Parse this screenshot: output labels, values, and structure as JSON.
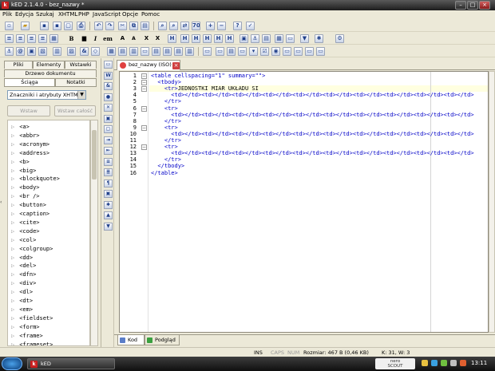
{
  "window": {
    "title": "kED 2.1.4.0 - bez_nazwy *",
    "app_icon": "k"
  },
  "menu": [
    "Plik",
    "Edycja",
    "Szukaj",
    "XHTML",
    "PHP",
    "JavaScript",
    "Opcje",
    "Pomoc"
  ],
  "toolbar2": {
    "bold": "B",
    "italic": "I",
    "em": "em",
    "big_a": "A",
    "small_a": "A",
    "sub_x": "X",
    "sup_x": "X"
  },
  "left_panel": {
    "tabs_row1": [
      "Pliki",
      "Elementy",
      "Wstawki"
    ],
    "tab_tree": "Drzewo dokumentu",
    "tabs_row2": [
      "Ściąga",
      "Notatki"
    ],
    "filter_value": "Znaczniki i atrybuty XHTML",
    "insert_button": "Wstaw",
    "insert_all_button": "Wstaw całość",
    "tags": [
      "<a>",
      "<abbr>",
      "<acronym>",
      "<address>",
      "<b>",
      "<big>",
      "<blockquote>",
      "<body>",
      "<br />",
      "<button>",
      "<caption>",
      "<cite>",
      "<code>",
      "<col>",
      "<colgroup>",
      "<dd>",
      "<del>",
      "<dfn>",
      "<div>",
      "<dl>",
      "<dt>",
      "<em>",
      "<fieldset>",
      "<form>",
      "<frame>",
      "<frameset>"
    ]
  },
  "editor": {
    "tab_label": "bez_nazwy (ISO)",
    "line_numbers": [
      "1",
      "2",
      "3",
      "4",
      "5",
      "6",
      "7",
      "8",
      "9",
      "10",
      "11",
      "12",
      "13",
      "14",
      "15",
      "16"
    ],
    "code_lines": [
      "<table cellspacing=\"1\" summary=\"\">",
      "  <tbody>",
      "    <tr>JEDNOSTKI MIAR UKŁADU SI",
      "      <td></td><td></td><td></td><td></td><td></td><td></td><td></td><td></td><td></td><td></td>",
      "    </tr>",
      "    <tr>",
      "      <td></td><td></td><td></td><td></td><td></td><td></td><td></td><td></td><td></td><td></td>",
      "    </tr>",
      "    <tr>",
      "      <td></td><td></td><td></td><td></td><td></td><td></td><td></td><td></td><td></td><td></td>",
      "    </tr>",
      "    <tr>",
      "      <td></td><td></td><td></td><td></td><td></td><td></td><td></td><td></td><td></td><td></td>",
      "    </tr>",
      "  </tbody>",
      "</table>"
    ],
    "bottom_tabs": [
      "Kod",
      "Podgląd"
    ]
  },
  "status": {
    "ins": "INS",
    "caps": "CAPS",
    "num": "NUM",
    "size": "Rozmiar: 467 B (0,46 KB)",
    "cursor": "K: 31, W: 3"
  },
  "taskbar": {
    "task_label": "kED",
    "nero": "nero",
    "nero_sub": "SCOUT",
    "clock": "13:11"
  },
  "colors": {
    "tag_blue": "#0000c8",
    "current_line": "#ffffe0",
    "titlebar": "#2b2b2b"
  }
}
